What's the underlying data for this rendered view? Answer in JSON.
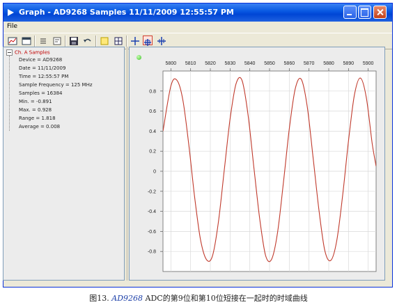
{
  "window": {
    "title": "Graph - AD9268 Samples 11/11/2009 12:55:57 PM",
    "menu": [
      "File"
    ]
  },
  "toolbar": {
    "tools": [
      "chart-icon",
      "close-graph-icon",
      "list-icon",
      "properties-icon",
      "save-icon",
      "undo-icon",
      "highlight-icon",
      "grid-icon",
      "crosshair-icon",
      "zoom-in-icon",
      "zoom-out-icon"
    ]
  },
  "tree": {
    "root": "Ch. A Samples",
    "items": [
      "Device = AD9268",
      "Date = 11/11/2009",
      "Time = 12:55:57 PM",
      "Sample Frequency = 125 MHz",
      "Samples = 16384",
      "Min. = -0.891",
      "Max. = 0.928",
      "Range = 1.818",
      "Average = 0.008"
    ]
  },
  "chart_data": {
    "type": "line",
    "title": "",
    "xlabel": "",
    "ylabel": "",
    "xlim": [
      5796,
      5904
    ],
    "ylim": [
      -1.0,
      1.0
    ],
    "x_ticks": [
      5800,
      5810,
      5820,
      5830,
      5840,
      5850,
      5860,
      5870,
      5880,
      5890,
      5900
    ],
    "x_tick_labels": [
      "5800",
      "5810",
      "5820",
      "5830",
      "5840",
      "5850",
      "5860",
      "5870",
      "5880",
      "5890",
      "5900"
    ],
    "y_ticks": [
      0.8,
      0.6,
      0.4,
      0.2,
      0,
      -0.2,
      -0.4,
      -0.6,
      -0.8
    ],
    "y_tick_labels": [
      "0.8",
      "0.6",
      "0.4",
      "0.2",
      "0",
      "-0.2",
      "-0.4",
      "-0.6",
      "-0.8"
    ],
    "x_axis_position": "top",
    "grid": true,
    "line_color": "#c0392b",
    "series": [
      {
        "x": [
          5796,
          5800,
          5803,
          5806,
          5809,
          5812,
          5815,
          5818,
          5821,
          5824,
          5827,
          5830,
          5833,
          5836,
          5839,
          5842,
          5845,
          5848,
          5851,
          5854,
          5857,
          5860,
          5863,
          5866,
          5869,
          5872,
          5875,
          5878,
          5881,
          5884,
          5887,
          5890,
          5893,
          5896,
          5899,
          5902,
          5904
        ],
        "y": [
          0.4,
          0.85,
          0.91,
          0.72,
          0.28,
          -0.25,
          -0.68,
          -0.88,
          -0.85,
          -0.52,
          0.0,
          0.52,
          0.87,
          0.91,
          0.58,
          0.05,
          -0.47,
          -0.84,
          -0.88,
          -0.62,
          -0.12,
          0.42,
          0.82,
          0.92,
          0.66,
          0.15,
          -0.38,
          -0.79,
          -0.89,
          -0.7,
          -0.25,
          0.3,
          0.76,
          0.93,
          0.74,
          0.28,
          0.05
        ]
      }
    ]
  },
  "caption": {
    "prefix": "图13.",
    "link": "AD9268",
    "text": "ADC的第9位和第10位短接在一起时的时域曲线"
  }
}
